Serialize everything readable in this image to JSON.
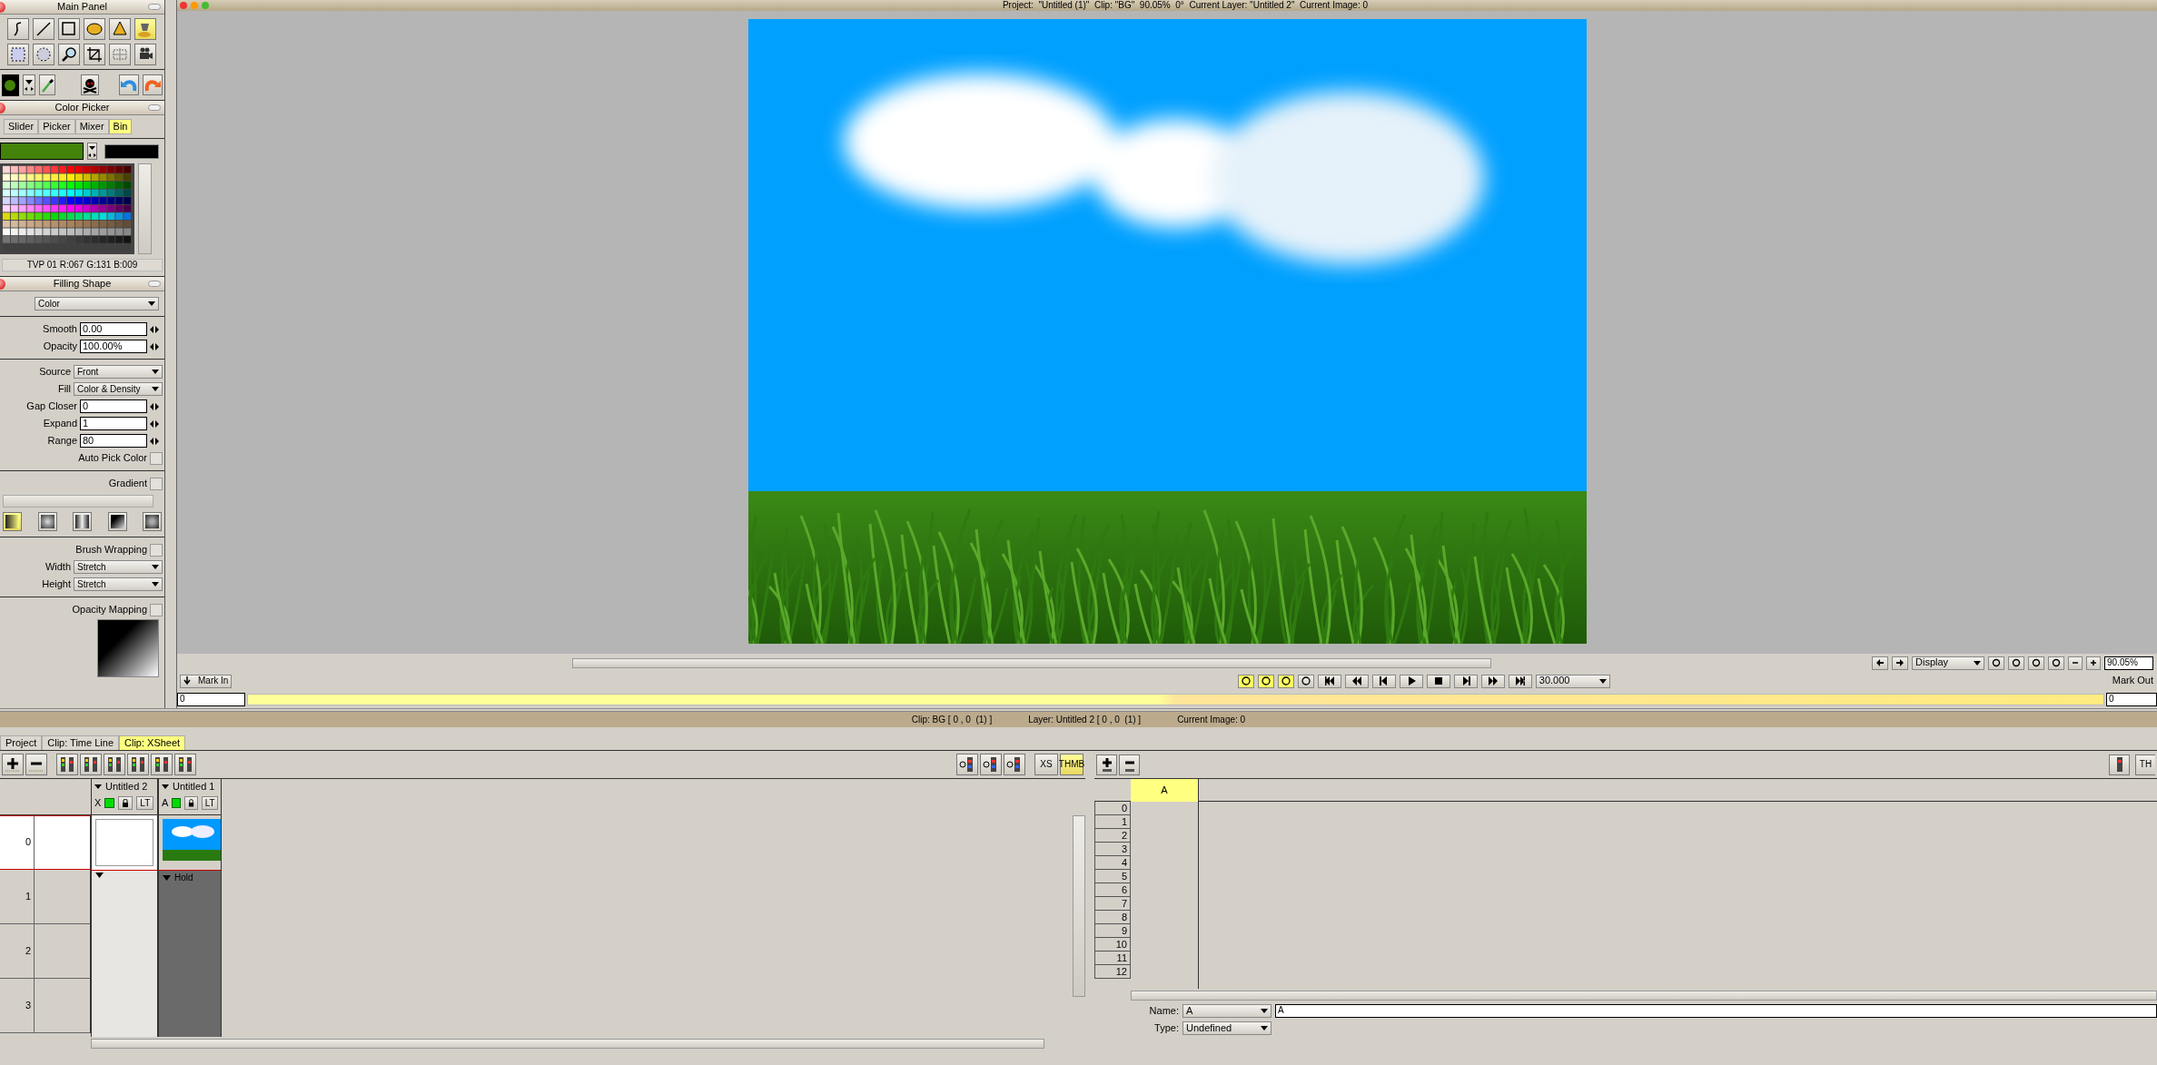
{
  "main_panel": {
    "title": "Main Panel",
    "tools": [
      {
        "selected": false
      },
      {
        "selected": false
      },
      {
        "selected": false
      },
      {
        "selected": false
      },
      {
        "selected": false
      },
      {
        "selected": true
      },
      {
        "selected": false
      },
      {
        "selected": false
      },
      {
        "selected": false
      },
      {
        "selected": false
      },
      {
        "selected": false
      },
      {
        "selected": false
      }
    ]
  },
  "color_picker": {
    "title": "Color Picker",
    "tabs": [
      {
        "label": "Slider",
        "selected": false
      },
      {
        "label": "Picker",
        "selected": false
      },
      {
        "label": "Mixer",
        "selected": false
      },
      {
        "label": "Bin",
        "selected": true
      }
    ],
    "status": "TVP 01 R:067 G:131 B:009"
  },
  "filling_shape": {
    "title": "Filling Shape",
    "groups": [
      [
        {
          "kind": "dropdown",
          "value": "Color"
        }
      ],
      [
        {
          "kind": "number",
          "label": "Smooth",
          "value": "0.00"
        },
        {
          "kind": "number",
          "label": "Opacity",
          "value": "100.00%"
        }
      ],
      [
        {
          "kind": "select",
          "label": "Source",
          "value": "Front"
        },
        {
          "kind": "select",
          "label": "Fill",
          "value": "Color & Density"
        },
        {
          "kind": "number",
          "label": "Gap Closer",
          "value": "0"
        },
        {
          "kind": "number",
          "label": "Expand",
          "value": "1"
        },
        {
          "kind": "number",
          "label": "Range",
          "value": "80"
        },
        {
          "kind": "checkbox",
          "label": "Auto Pick Color",
          "checked": false
        }
      ],
      [
        {
          "kind": "checkbox",
          "label": "Gradient",
          "checked": false
        },
        {
          "kind": "gradient_bar"
        },
        {
          "kind": "gradient_types",
          "types": [
            {
              "selected": true
            },
            {
              "selected": false
            },
            {
              "selected": false
            },
            {
              "selected": false
            },
            {
              "selected": false
            }
          ]
        }
      ],
      [
        {
          "kind": "checkbox",
          "label": "Brush Wrapping",
          "checked": false
        },
        {
          "kind": "select",
          "label": "Width",
          "value": "Stretch"
        },
        {
          "kind": "select",
          "label": "Height",
          "value": "Stretch"
        }
      ],
      [
        {
          "kind": "checkbox",
          "label": "Opacity Mapping",
          "checked": false
        },
        {
          "kind": "mapping_preview"
        }
      ]
    ]
  },
  "viewer": {
    "title": "Project:  \"Untitled (1)\"  Clip: \"BG\"  90.05%  0°  Current Layer: \"Untitled 2\"  Current Image: 0"
  },
  "transport": {
    "mark_in": "Mark In",
    "mark_out": "Mark Out",
    "frame_start": "0",
    "frame_end": "0",
    "fps": "30.000",
    "display": "Display",
    "zoom": "90.05%",
    "toggles": [
      {
        "on": true
      },
      {
        "on": true
      },
      {
        "on": true
      },
      {
        "on": false
      }
    ]
  },
  "status_bar": [
    "Clip: BG [ 0 , 0  (1) ]",
    "Layer: Untitled 2 [ 0 , 0  (1) ]",
    "Current Image: 0"
  ],
  "tabs": [
    {
      "label": "Project",
      "selected": false
    },
    {
      "label": "Clip: Time Line",
      "selected": false
    },
    {
      "label": "Clip: XSheet",
      "selected": true
    }
  ],
  "xsheet": {
    "view_toggles": [
      {
        "label": "XS",
        "selected": false
      },
      {
        "label": "THMB",
        "selected": true
      }
    ],
    "layers": [
      {
        "name": "Untitled 2",
        "tag": "X",
        "lock_label": "LT",
        "kind": "empty"
      },
      {
        "name": "Untitled 1",
        "tag": "A",
        "lock_label": "LT",
        "kind": "image",
        "hold": "Hold"
      }
    ],
    "rows": [
      {
        "label": "0",
        "selected": true
      },
      {
        "label": "1",
        "selected": false
      },
      {
        "label": "2",
        "selected": false
      },
      {
        "label": "3",
        "selected": false
      }
    ]
  },
  "source_sheet": {
    "columns": [
      {
        "label": "A",
        "selected": true
      }
    ],
    "rows": [
      "0",
      "1",
      "2",
      "3",
      "4",
      "5",
      "6",
      "7",
      "8",
      "9",
      "10",
      "11",
      "12"
    ],
    "name_label": "Name:",
    "name_select": "A",
    "name_value": "A",
    "type_label": "Type:",
    "type_value": "Undefined",
    "cut_toggle": "TH"
  }
}
